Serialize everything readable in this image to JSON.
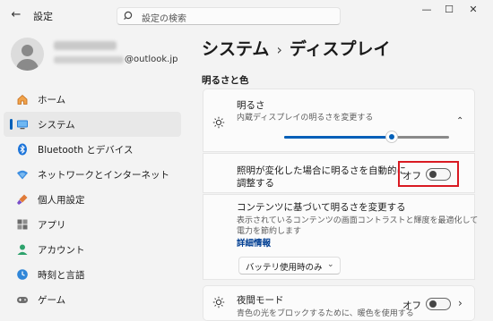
{
  "window": {
    "back_glyph": "←",
    "title": "設定",
    "controls": {
      "minimize": "—",
      "maximize": "☐",
      "close": "✕"
    }
  },
  "search": {
    "placeholder": "設定の検索"
  },
  "user": {
    "email_domain": "@outlook.jp"
  },
  "sidebar": {
    "items": [
      {
        "label": "ホーム",
        "icon": "home-icon",
        "active": false
      },
      {
        "label": "システム",
        "icon": "monitor-icon",
        "active": true
      },
      {
        "label": "Bluetooth とデバイス",
        "icon": "bluetooth-icon",
        "active": false
      },
      {
        "label": "ネットワークとインターネット",
        "icon": "wifi-icon",
        "active": false
      },
      {
        "label": "個人用設定",
        "icon": "brush-icon",
        "active": false
      },
      {
        "label": "アプリ",
        "icon": "apps-icon",
        "active": false
      },
      {
        "label": "アカウント",
        "icon": "person-icon",
        "active": false
      },
      {
        "label": "時刻と言語",
        "icon": "clock-globe-icon",
        "active": false
      },
      {
        "label": "ゲーム",
        "icon": "gamepad-icon",
        "active": false
      }
    ]
  },
  "header": {
    "breadcrumb_parent": "システム",
    "separator": "›",
    "page": "ディスプレイ"
  },
  "section": {
    "title": "明るさと色"
  },
  "brightness": {
    "title": "明るさ",
    "subtitle": "内蔵ディスプレイの明るさを変更する",
    "level": 0.65,
    "chevron": "⌃"
  },
  "auto_brightness": {
    "label_line1": "照明が変化した場合に明るさを自動的に",
    "label_line2": "調整する",
    "state": "オフ"
  },
  "content_brightness": {
    "title": "コンテンツに基づいて明るさを変更する",
    "desc_line1": "表示されているコンテンツの画面コントラストと輝度を最適化して",
    "desc_line2": "電力を節約します",
    "link": "詳細情報",
    "dropdown_value": "バッテリ使用時のみ",
    "dropdown_chevron": "⌄"
  },
  "night_light": {
    "title": "夜間モード",
    "subtitle": "青色の光をブロックするために、暖色を使用する",
    "state": "オフ",
    "chevron": "›"
  },
  "colors": {
    "accent": "#005fb8",
    "highlight": "#d91a22"
  }
}
